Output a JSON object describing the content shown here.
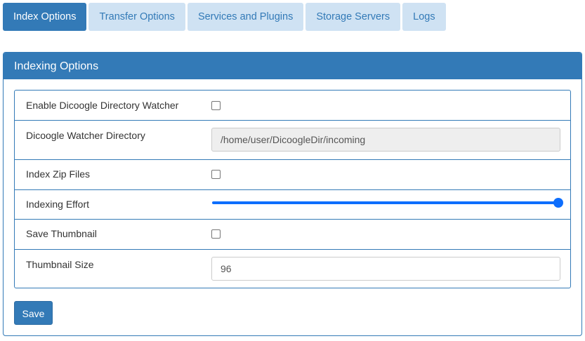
{
  "tabs": [
    {
      "label": "Index Options",
      "active": true
    },
    {
      "label": "Transfer Options",
      "active": false
    },
    {
      "label": "Services and Plugins",
      "active": false
    },
    {
      "label": "Storage Servers",
      "active": false
    },
    {
      "label": "Logs",
      "active": false
    }
  ],
  "panel": {
    "title": "Indexing Options",
    "rows": {
      "watcher_enabled": {
        "label": "Enable Dicoogle Directory Watcher",
        "checked": false
      },
      "watcher_directory": {
        "label": "Dicoogle Watcher Directory",
        "value": "/home/user/DicoogleDir/incoming"
      },
      "index_zip": {
        "label": "Index Zip Files",
        "checked": false
      },
      "indexing_effort": {
        "label": "Indexing Effort",
        "value": 100
      },
      "save_thumbnail": {
        "label": "Save Thumbnail",
        "checked": false
      },
      "thumbnail_size": {
        "label": "Thumbnail Size",
        "value": "96"
      }
    },
    "save_label": "Save"
  },
  "colors": {
    "primary": "#337ab7",
    "tab_inactive_bg": "#cfe2f3",
    "slider": "#0d6efd"
  }
}
